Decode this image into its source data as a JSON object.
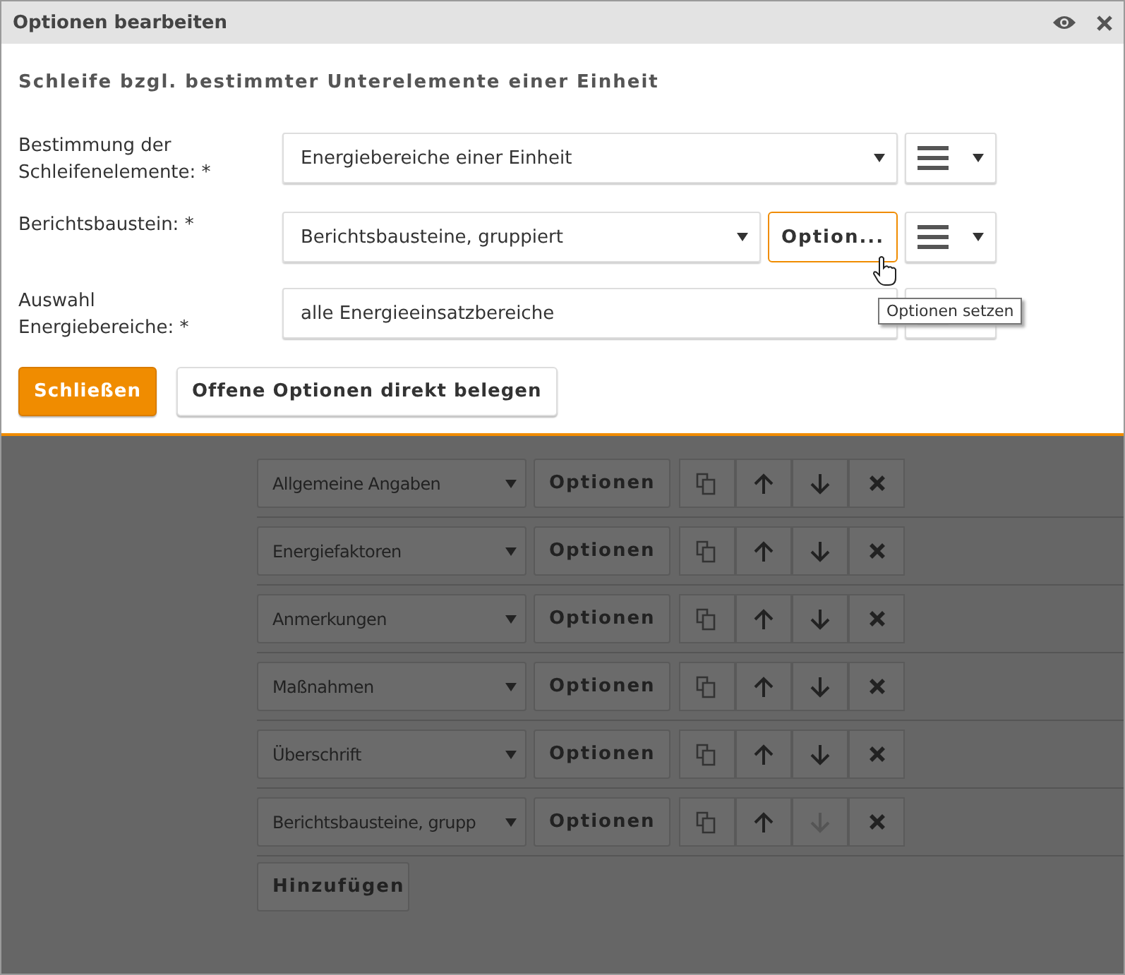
{
  "window": {
    "title": "Optionen bearbeiten"
  },
  "heading": "Schleife bzgl. bestimmter Unterelemente einer Einheit",
  "fields": [
    {
      "label": "Bestimmung der Schleifenelemente: *",
      "kind": "select",
      "value": "Energiebereiche einer Einheit"
    },
    {
      "label": "Berichtsbaustein: *",
      "kind": "select",
      "value": "Berichtsbausteine, gruppiert",
      "option_button": "Option..."
    },
    {
      "label": "Auswahl Energiebereiche: *",
      "kind": "input",
      "value": "alle Energieeinsatzbereiche"
    }
  ],
  "tooltip": "Optionen setzen",
  "buttons": [
    {
      "label": "Schließen",
      "kind": "primary"
    },
    {
      "label": "Offene Optionen direkt belegen",
      "kind": "default"
    }
  ],
  "items": [
    {
      "name": "Allgemeine Angaben",
      "options": "Optionen",
      "down_disabled": false
    },
    {
      "name": "Energiefaktoren",
      "options": "Optionen",
      "down_disabled": false
    },
    {
      "name": "Anmerkungen",
      "options": "Optionen",
      "down_disabled": false
    },
    {
      "name": "Maßnahmen",
      "options": "Optionen",
      "down_disabled": false
    },
    {
      "name": "Überschrift",
      "options": "Optionen",
      "down_disabled": false
    },
    {
      "name": "Berichtsbausteine, grupp",
      "options": "Optionen",
      "down_disabled": true
    }
  ],
  "add_button": "Hinzufügen"
}
